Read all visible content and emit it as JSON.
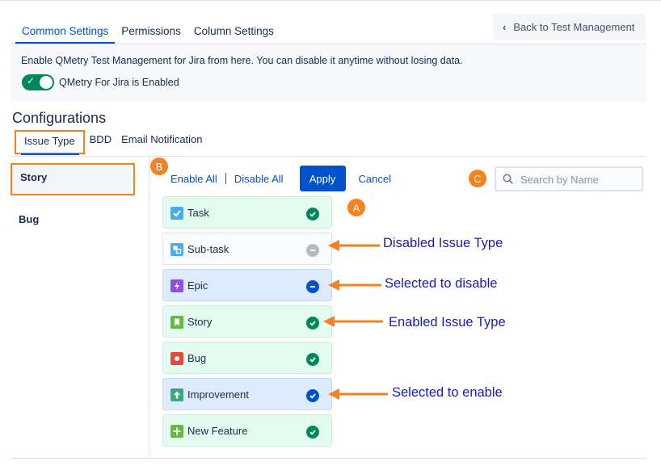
{
  "top_tabs": [
    {
      "label": "Common Settings"
    },
    {
      "label": "Permissions"
    },
    {
      "label": "Column Settings"
    }
  ],
  "back_button": {
    "label": "Back to Test Management"
  },
  "banner": {
    "text": "Enable QMetry Test Management for Jira from here. You can disable it anytime without losing data.",
    "toggle_label": "QMetry For Jira is Enabled"
  },
  "configurations": {
    "title": "Configurations",
    "tabs": [
      {
        "label": "Issue Type"
      },
      {
        "label": "BDD"
      },
      {
        "label": "Email Notification"
      }
    ]
  },
  "left_list": [
    {
      "label": "Story"
    },
    {
      "label": "Bug"
    }
  ],
  "actions": {
    "enable_all": "Enable All",
    "disable_all": "Disable All",
    "apply": "Apply",
    "cancel": "Cancel"
  },
  "search": {
    "placeholder": "Search by Name"
  },
  "badges": {
    "a": "A",
    "b": "B",
    "c": "C"
  },
  "issue_types": [
    {
      "label": "Task",
      "status": "enabled",
      "icon": "task-icon",
      "color": "#4bade8"
    },
    {
      "label": "Sub-task",
      "status": "disabled",
      "icon": "subtask-icon",
      "color": "#4bade8"
    },
    {
      "label": "Epic",
      "status": "selected-disable",
      "icon": "epic-icon",
      "color": "#904ee2"
    },
    {
      "label": "Story",
      "status": "enabled",
      "icon": "story-icon",
      "color": "#63ba3c"
    },
    {
      "label": "Bug",
      "status": "enabled",
      "icon": "bug-icon",
      "color": "#e5493a"
    },
    {
      "label": "Improvement",
      "status": "selected-enable",
      "icon": "improvement-icon",
      "color": "#3ca77a"
    },
    {
      "label": "New Feature",
      "status": "enabled",
      "icon": "new-feature-icon",
      "color": "#63ba3c"
    }
  ],
  "annotations": {
    "disabled": "Disabled Issue Type",
    "selected_disable": "Selected to disable",
    "enabled": "Enabled Issue Type",
    "selected_enable": "Selected to enable"
  },
  "colors": {
    "accent": "#0052cc",
    "orange": "#f58220",
    "enabled_green": "#00875a",
    "annotation_text": "#1a1ab5"
  }
}
